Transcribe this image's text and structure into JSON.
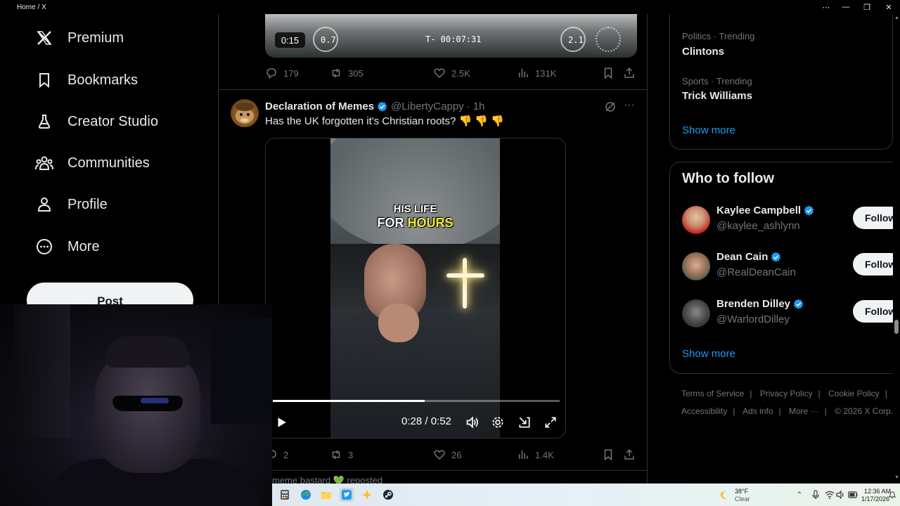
{
  "window": {
    "title": "Home / X",
    "controls": [
      "more-icon",
      "minimize-icon",
      "restore-icon",
      "close-icon"
    ]
  },
  "sidebar": {
    "items": [
      {
        "label": "Premium",
        "icon": "x-logo-icon"
      },
      {
        "label": "Bookmarks",
        "icon": "bookmark-icon"
      },
      {
        "label": "Creator Studio",
        "icon": "flask-icon"
      },
      {
        "label": "Communities",
        "icon": "communities-icon"
      },
      {
        "label": "Profile",
        "icon": "person-icon"
      },
      {
        "label": "More",
        "icon": "more-circle-icon"
      }
    ],
    "post_label": "Post"
  },
  "feed": {
    "prev_video": {
      "duration_badge": "0:15",
      "hud_left": "0.7",
      "hud_center": "T- 00:07:31",
      "hud_right": "2.1"
    },
    "prev_actions": {
      "replies": "179",
      "reposts": "305",
      "likes": "2.5K",
      "views": "131K"
    },
    "tweet": {
      "name": "Declaration of Memes",
      "handle": "@LibertyCappy",
      "time": "· 1h",
      "text": "Has the UK forgotten it's Christian roots? 👎 👎 👎",
      "caption_line1": "HIS LIFE",
      "caption_line2_a": "FOR",
      "caption_line2_b": "HOURS",
      "video_time": "0:28 / 0:52",
      "progress": 0.53,
      "actions": {
        "replies": "2",
        "reposts": "3",
        "likes": "26",
        "views": "1.4K"
      }
    },
    "next_repost": "meme bastard 💚 reposted"
  },
  "right": {
    "trends": [
      {
        "meta": "Politics · Trending",
        "name": "Clintons"
      },
      {
        "meta": "Sports · Trending",
        "name": "Trick Williams"
      }
    ],
    "show_more": "Show more",
    "who_to_follow": {
      "title": "Who to follow",
      "users": [
        {
          "name": "Kaylee Campbell",
          "handle": "@kaylee_ashlynn",
          "button": "Follow"
        },
        {
          "name": "Dean Cain",
          "handle": "@RealDeanCain",
          "button": "Follow"
        },
        {
          "name": "Brenden Dilley",
          "handle": "@WarlordDilley",
          "button": "Follow"
        }
      ],
      "show_more": "Show more"
    },
    "footer": {
      "row1": [
        "Terms of Service",
        "Privacy Policy",
        "Cookie Policy"
      ],
      "row2": [
        "Accessibility",
        "Ads info",
        "More ···",
        "© 2026 X Corp."
      ]
    }
  },
  "taskbar": {
    "weather_temp": "38°F",
    "weather_desc": "Clear",
    "time": "12:36 AM",
    "date": "1/17/2026"
  },
  "colors": {
    "accent": "#1d9bf0",
    "background": "#000000",
    "border": "#2f3336",
    "muted": "#71767b"
  }
}
